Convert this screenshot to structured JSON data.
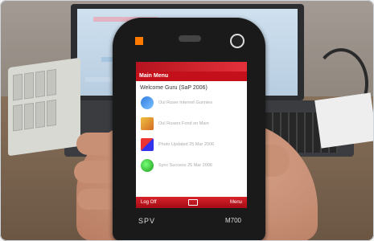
{
  "phone": {
    "brand": "SPV",
    "model": "M700",
    "titlebar": "",
    "menu_title": "Main Menu",
    "welcome": "Welcome Guru (SaP 2006)",
    "items": [
      {
        "icon": "internet-icon",
        "label": "Oul Ruser Internet Gunnies"
      },
      {
        "icon": "archive-icon",
        "label": "Oul Rusers Fond on Main"
      },
      {
        "icon": "windows-icon",
        "label": "Photo Updated 25 Mar 2006"
      },
      {
        "icon": "globe-icon",
        "label": "Sync Success 25 Mar 2006"
      }
    ],
    "soft_left": "Log Off",
    "soft_right": "Menu"
  },
  "colors": {
    "accent": "#c4101a",
    "orange_logo": "#ff7a00"
  }
}
